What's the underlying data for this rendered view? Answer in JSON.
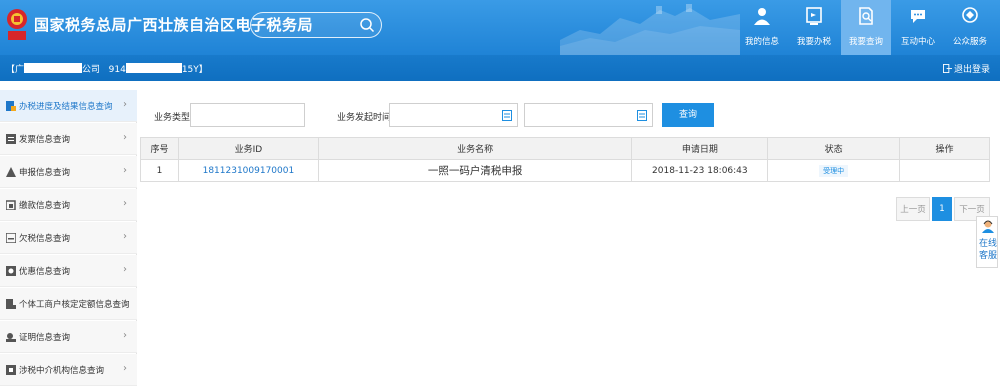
{
  "header": {
    "title": "国家税务总局广西壮族自治区电子税务局",
    "search": {
      "value": "",
      "placeholder": ""
    },
    "nav": [
      {
        "label": "我的信息",
        "icon": "person-icon"
      },
      {
        "label": "我要办税",
        "icon": "tax-form-icon"
      },
      {
        "label": "我要查询",
        "icon": "query-doc-icon"
      },
      {
        "label": "互动中心",
        "icon": "chat-icon"
      },
      {
        "label": "公众服务",
        "icon": "service-icon"
      }
    ]
  },
  "account": {
    "bracket_open": "【广",
    "company_suffix": "公司",
    "tax_id_prefix": "914",
    "tax_id_suffix": "15Y】",
    "logout_label": "退出登录"
  },
  "sidebar": {
    "items": [
      {
        "label": "办税进度及结果信息查询",
        "icon": "progress-icon"
      },
      {
        "label": "发票信息查询",
        "icon": "invoice-icon"
      },
      {
        "label": "申报信息查询",
        "icon": "declare-icon"
      },
      {
        "label": "缴款信息查询",
        "icon": "payment-icon"
      },
      {
        "label": "欠税信息查询",
        "icon": "arrears-icon"
      },
      {
        "label": "优惠信息查询",
        "icon": "discount-icon"
      },
      {
        "label": "个体工商户核定定额信息查询",
        "icon": "merchant-icon"
      },
      {
        "label": "证明信息查询",
        "icon": "certificate-icon"
      },
      {
        "label": "涉税中介机构信息查询",
        "icon": "agency-icon"
      }
    ],
    "chevron": "›"
  },
  "filters": {
    "business_type_label": "业务类型:",
    "business_type_value": "",
    "start_time_label": "业务发起时间:",
    "start_from": "",
    "start_to": "",
    "query_button": "查询"
  },
  "table": {
    "headers": [
      "序号",
      "业务ID",
      "业务名称",
      "申请日期",
      "状态",
      "操作"
    ],
    "rows": [
      {
        "index": "1",
        "id": "1811231009170001",
        "name": "一照一码户清税申报",
        "date": "2018-11-23 18:06:43",
        "status": "受理中",
        "action": ""
      }
    ]
  },
  "pager": {
    "prev": "上一页",
    "current": "1",
    "next": "下一页"
  },
  "service_widget": {
    "line1": "在线",
    "line2": "客服"
  },
  "colors": {
    "header_blue": "#2a8ee0",
    "accent": "#1e8fe1",
    "link": "#1e77c9"
  }
}
